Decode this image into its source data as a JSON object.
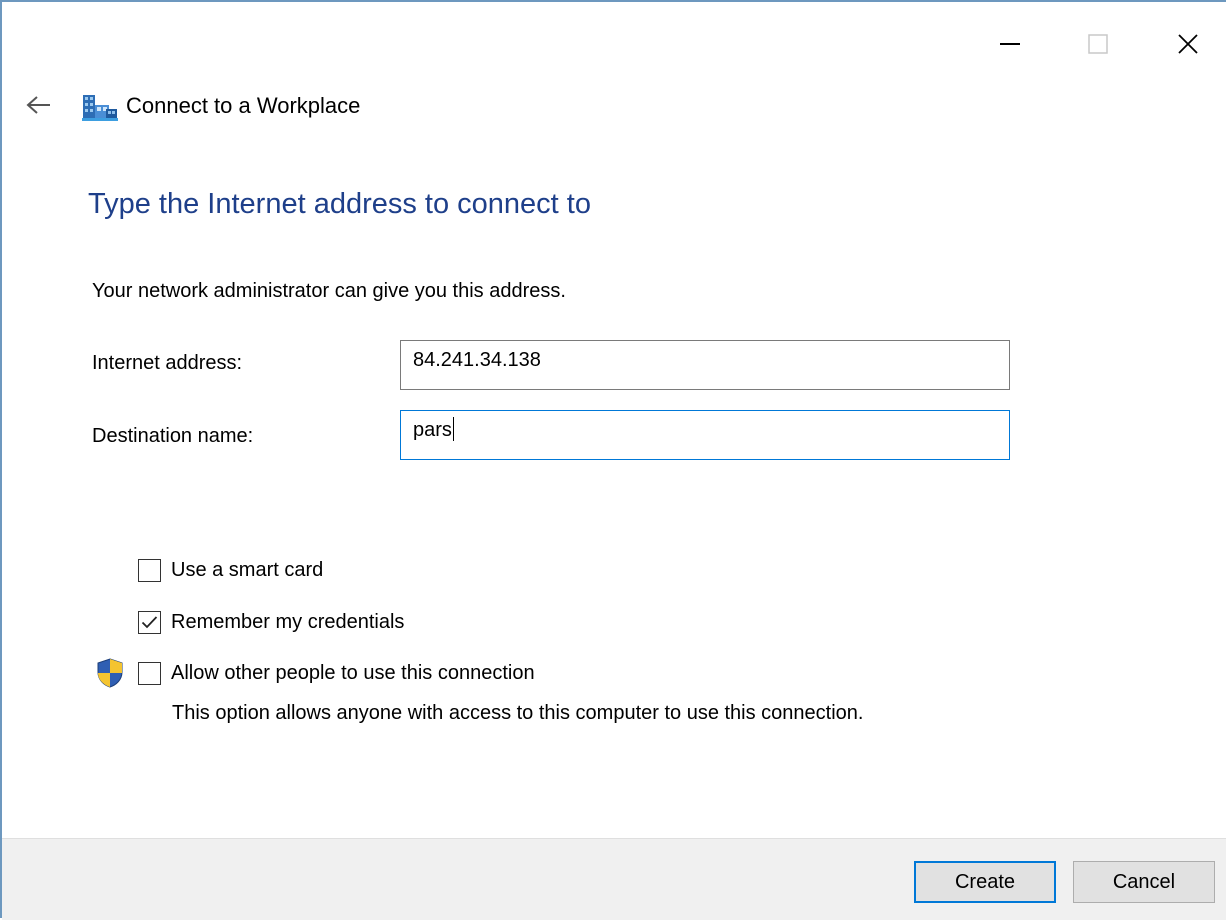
{
  "window": {
    "title": "Connect to a Workplace",
    "controls": {
      "minimize_icon": "minimize-icon",
      "maximize_icon": "maximize-icon",
      "close_icon": "close-icon"
    },
    "accent_color": "#0078d7",
    "heading_color": "#1e3f8a"
  },
  "page": {
    "heading": "Type the Internet address to connect to",
    "intro": "Your network administrator can give you this address."
  },
  "fields": {
    "internet_address": {
      "label": "Internet address:",
      "value": "84.241.34.138"
    },
    "destination_name": {
      "label": "Destination name:",
      "value": "pars"
    }
  },
  "options": [
    {
      "label": "Use a smart card",
      "checked": false
    },
    {
      "label": "Remember my credentials",
      "checked": true
    },
    {
      "label": "Allow other people to use this connection",
      "checked": false
    }
  ],
  "allow_note": "This option allows anyone with access to this computer to use this connection.",
  "buttons": {
    "create": "Create",
    "cancel": "Cancel"
  }
}
